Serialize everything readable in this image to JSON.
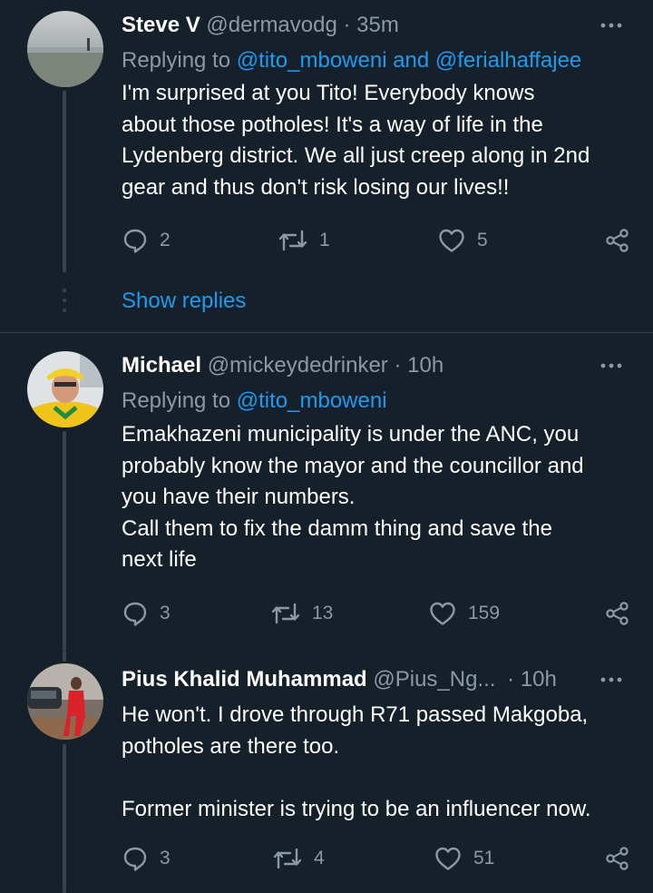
{
  "colors": {
    "background": "#15202b",
    "text_primary": "#ffffff",
    "text_secondary": "#8b98a5",
    "link": "#1d9bf0",
    "divider": "#38444d"
  },
  "tweets": [
    {
      "name": "Steve V",
      "handle": "@dermavodg",
      "dot": "·",
      "time": "35m",
      "reply_prefix": "Replying to",
      "mentions": "@tito_mboweni and @ferialhaffajee",
      "text": "I'm surprised at you Tito! Everybody knows\nabout those potholes! It's a way of life in the\nLydenberg district. We all just creep along in 2nd\ngear and thus don't risk losing our lives!!",
      "replies": "2",
      "retweets": "1",
      "likes": "5",
      "show_replies": "Show replies"
    },
    {
      "name": "Michael",
      "handle": "@mickeydedrinker",
      "dot": "·",
      "time": "10h",
      "reply_prefix": "Replying to",
      "mentions": "@tito_mboweni",
      "text": "Emakhazeni municipality is under the ANC, you\nprobably know the mayor and the councillor and\nyou have their numbers.\nCall them to fix the damm thing and save the\nnext life",
      "replies": "3",
      "retweets": "13",
      "likes": "159"
    },
    {
      "name": "Pius Khalid Muhammad",
      "handle": "@Pius_Ng...",
      "dot": "·",
      "time": "10h",
      "text": "He won't. I drove through R71 passed Makgoba,\npotholes are there too.\n\nFormer minister is trying to be an influencer now.",
      "replies": "3",
      "retweets": "4",
      "likes": "51"
    }
  ],
  "icons": [
    "more-icon",
    "reply-icon",
    "retweet-icon",
    "like-icon",
    "share-icon"
  ]
}
